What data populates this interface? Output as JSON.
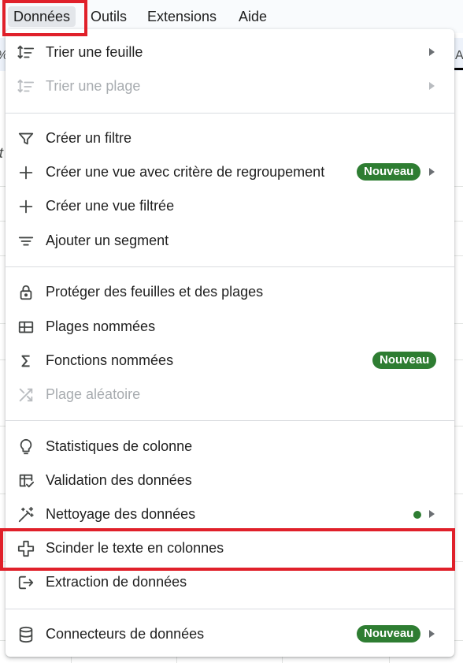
{
  "menubar": {
    "items": [
      {
        "label": "Données"
      },
      {
        "label": "Outils"
      },
      {
        "label": "Extensions"
      },
      {
        "label": "Aide"
      }
    ]
  },
  "background": {
    "left_glyph": "%",
    "right_glyph": "A",
    "italic_glyph": "t"
  },
  "menu": {
    "sort_sheet": {
      "label": "Trier une feuille",
      "icon": "sort-icon",
      "enabled": true,
      "has_submenu": true
    },
    "sort_range": {
      "label": "Trier une plage",
      "icon": "sort-icon",
      "enabled": false,
      "has_submenu": true
    },
    "create_filter": {
      "label": "Créer un filtre",
      "icon": "filter-icon",
      "enabled": true
    },
    "group_view": {
      "label": "Créer une vue avec critère de regroupement",
      "icon": "plus-icon",
      "badge": "Nouveau",
      "has_submenu": true
    },
    "filter_view": {
      "label": "Créer une vue filtrée",
      "icon": "plus-icon"
    },
    "add_slicer": {
      "label": "Ajouter un segment",
      "icon": "slicer-icon"
    },
    "protect": {
      "label": "Protéger des feuilles et des plages",
      "icon": "lock-icon"
    },
    "named_ranges": {
      "label": "Plages nommées",
      "icon": "named-range-icon"
    },
    "named_functions": {
      "label": "Fonctions nommées",
      "icon": "sigma-icon",
      "badge": "Nouveau"
    },
    "random_range": {
      "label": "Plage aléatoire",
      "icon": "shuffle-icon",
      "enabled": false
    },
    "column_stats": {
      "label": "Statistiques de colonne",
      "icon": "lightbulb-icon"
    },
    "data_validation": {
      "label": "Validation des données",
      "icon": "validation-icon"
    },
    "data_cleanup": {
      "label": "Nettoyage des données",
      "icon": "magic-wand-icon",
      "has_dot": true,
      "has_submenu": true
    },
    "split_text": {
      "label": "Scinder le texte en colonnes",
      "icon": "split-columns-icon",
      "highlighted": true
    },
    "data_extraction": {
      "label": "Extraction de données",
      "icon": "extract-icon"
    },
    "data_connectors": {
      "label": "Connecteurs de données",
      "icon": "database-icon",
      "badge": "Nouveau",
      "has_submenu": true
    }
  },
  "colors": {
    "highlight_red": "#e0202a",
    "badge_green": "#2e7d32",
    "disabled_text": "#a8acb0"
  }
}
